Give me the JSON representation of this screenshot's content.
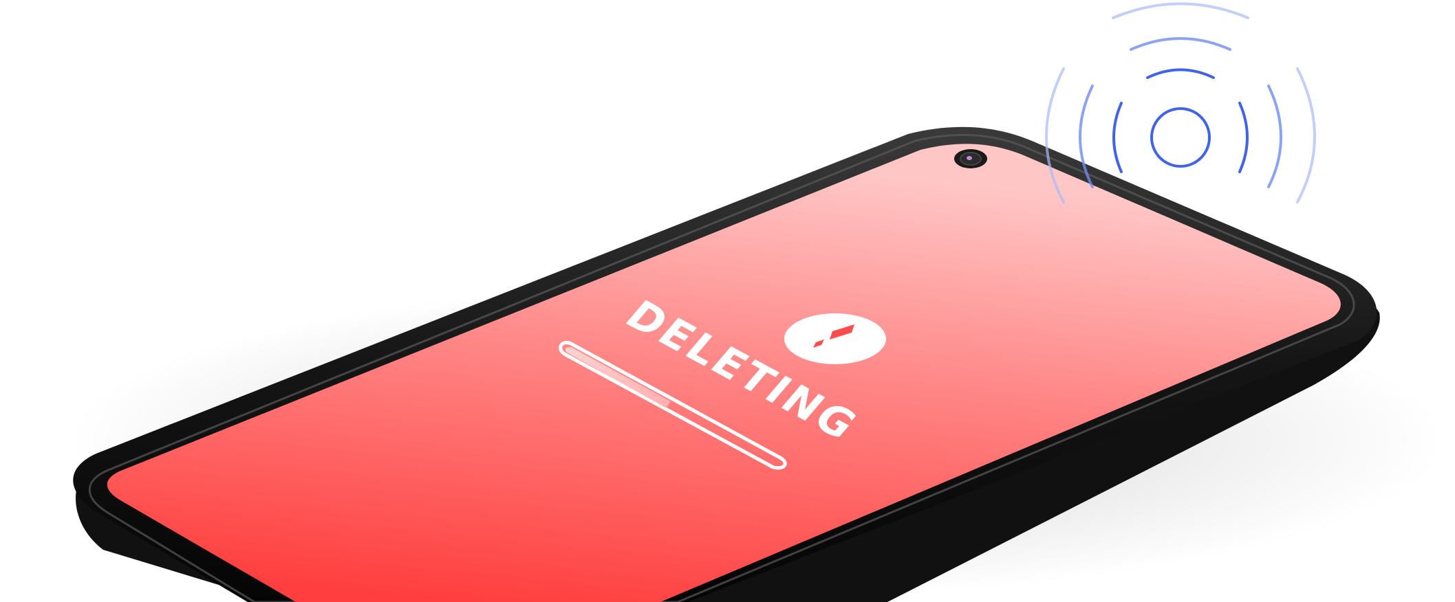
{
  "scene": {
    "background_color": "#ffffff",
    "subject": "smartphone",
    "screen": {
      "gradient_top": "#ffc4c4",
      "gradient_bottom": "#ff4545",
      "status_label": "DELETING",
      "status_icon": "exclamation-icon",
      "progress": {
        "value_fraction": 0.4,
        "track_color": "#ffffff",
        "fill_color": "#ffd0d0"
      }
    },
    "front_camera_icon": "camera-icon",
    "signal": {
      "icon": "wireless-signal-icon",
      "color": "#3f63ea",
      "ring_count": 3
    }
  }
}
